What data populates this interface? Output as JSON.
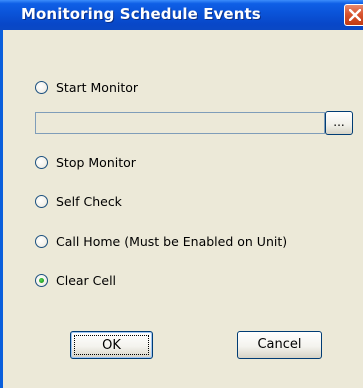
{
  "window": {
    "title": "Monitoring Schedule Events"
  },
  "options": [
    {
      "label": "Start Monitor",
      "checked": false
    },
    {
      "label": "Stop Monitor",
      "checked": false
    },
    {
      "label": "Self Check",
      "checked": false
    },
    {
      "label": "Call Home (Must be Enabled on Unit)",
      "checked": false
    },
    {
      "label": "Clear Cell",
      "checked": true
    }
  ],
  "path_field": {
    "value": ""
  },
  "browse_button": {
    "label": "..."
  },
  "buttons": {
    "ok_label": "OK",
    "cancel_label": "Cancel"
  },
  "icons": {
    "close": "close-icon"
  },
  "colors": {
    "titlebar": "#0a53d8",
    "dialog_bg": "#ece9d8",
    "close_button": "#d8542f",
    "radio_selected": "#21a121"
  }
}
